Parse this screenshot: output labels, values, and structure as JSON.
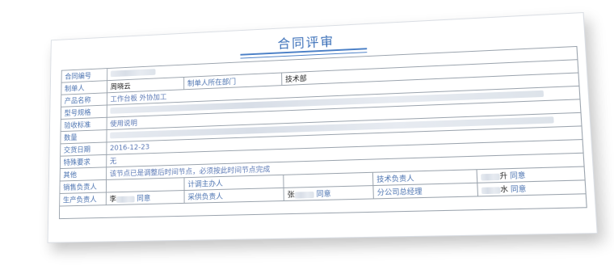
{
  "title": "合同评审",
  "rows": {
    "contract_no": {
      "label": "合同编号",
      "value": ""
    },
    "creator": {
      "label": "制单人",
      "value": "周晓云",
      "dept_label": "制单人所在部门",
      "dept_value": "技术部"
    },
    "product_name": {
      "label": "产品名称",
      "value": "工作台板 外协加工"
    },
    "model_spec": {
      "label": "型号规格",
      "value": ""
    },
    "acceptance": {
      "label": "验收标准",
      "value": "使用说明"
    },
    "quantity": {
      "label": "数量",
      "value": ""
    },
    "delivery_date": {
      "label": "交货日期",
      "value": "2016-12-23"
    },
    "special": {
      "label": "特殊要求",
      "value": "无"
    },
    "other": {
      "label": "其他",
      "value": "该节点已是调整后时间节点，必须按此时间节点完成"
    }
  },
  "approvals": {
    "sales_lead": {
      "label": "销售负责人",
      "value": ""
    },
    "planning_lead": {
      "label": "计调主办人",
      "value": ""
    },
    "tech_lead": {
      "label": "技术负责人",
      "name_suffix": "升",
      "status": "同意"
    },
    "production_lead": {
      "label": "生产负责人",
      "name_prefix": "李",
      "status": "同意"
    },
    "purchase_lead": {
      "label": "采供负责人",
      "name_prefix": "张",
      "status": "同意"
    },
    "branch_gm": {
      "label": "分公司总经理",
      "name_prefix": "",
      "name_suffix": "水",
      "status": "同意"
    }
  }
}
